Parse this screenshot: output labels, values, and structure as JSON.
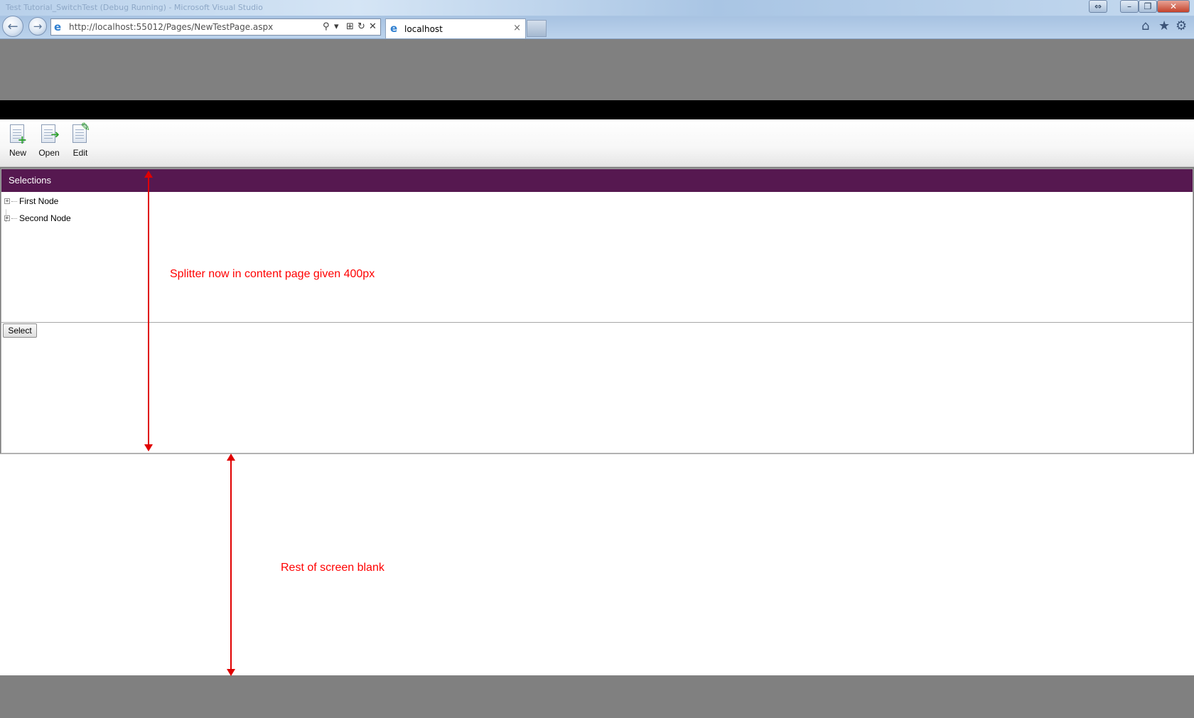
{
  "browser": {
    "window_title": "Test Tutorial_SwitchTest (Debug Running) - Microsoft Visual Studio",
    "address": "http://localhost:55012/Pages/NewTestPage.aspx",
    "tab_title": "localhost",
    "tab_close": "×",
    "nav_back": "←",
    "nav_forward": "→",
    "window_buttons": {
      "restore_alt": "⇔",
      "minimize": "–",
      "maximize": "❐",
      "close": "✕"
    },
    "addr_buttons": {
      "search": "⚲",
      "dropdown": "▾",
      "compat": "⊞",
      "refresh": "↻",
      "stop": "✕"
    },
    "right_icons": {
      "home": "⌂",
      "favorites": "★",
      "tools": "⚙"
    }
  },
  "toolbar": {
    "items": [
      {
        "label": "New",
        "icon": "new-document-icon"
      },
      {
        "label": "Open",
        "icon": "open-document-icon"
      },
      {
        "label": "Edit",
        "icon": "edit-document-icon"
      }
    ]
  },
  "selections": {
    "title": "Selections",
    "nodes": [
      {
        "label": "First Node",
        "expander": "+"
      },
      {
        "label": "Second Node",
        "expander": "+"
      }
    ],
    "select_button": "Select"
  },
  "annotations": {
    "splitter": "Splitter now in content page given 400px",
    "blank": "Rest of screen blank"
  },
  "colors": {
    "header_purple": "#561850",
    "annotation_red": "#ff0000",
    "background_gray": "#808080"
  }
}
